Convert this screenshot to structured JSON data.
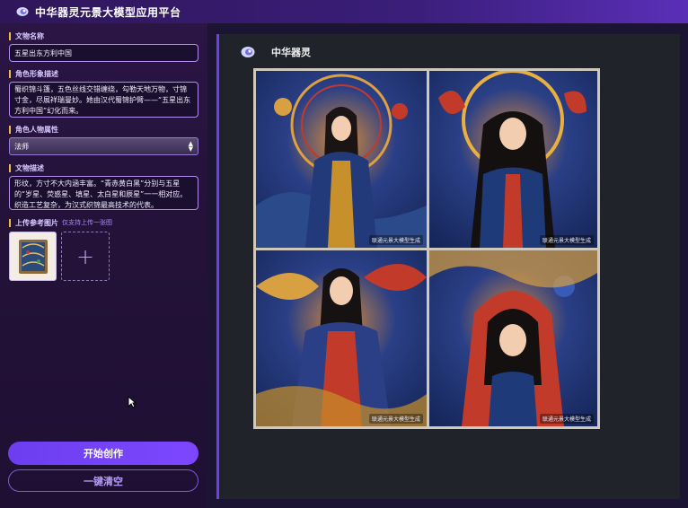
{
  "app": {
    "title": "中华器灵元景大模型应用平台"
  },
  "sidebar": {
    "artifact_name": {
      "label": "文物名称",
      "value": "五星出东方利中国"
    },
    "character_desc": {
      "label": "角色形象描述",
      "value": "蜀织锦斗篷，五色丝线交错缠绕，勾勒天地万物，寸锦寸金，尽展祥瑞曼妙。她由汉代蜀锦护臂——“五星出东方利中国”幻化而来。"
    },
    "character_attr": {
      "label": "角色人物属性",
      "value": "法师"
    },
    "artifact_desc": {
      "label": "文物描述",
      "value": "形纹，方寸不大内涵丰富。“青赤黄白黑”分别与五星的“岁星、荧惑星、填星、太白星和辰星”一一相对应。织造工艺复杂，为汉式织锦最高技术的代表。"
    },
    "upload": {
      "label": "上传参考图片",
      "hint": "仅支持上传一张图"
    },
    "start_button": "开始创作",
    "clear_button": "一键清空"
  },
  "panel": {
    "title": "中华器灵",
    "images": [
      {
        "caption": "联通元景大模型生成"
      },
      {
        "caption": "联通元景大模型生成"
      },
      {
        "caption": "联通元景大模型生成"
      },
      {
        "caption": "联通元景大模型生成"
      }
    ]
  },
  "colors": {
    "accent": "#6c3ef0",
    "topbar": "#3a1e7a",
    "sidebar_bg": "#241238",
    "panel_bg": "#20232a",
    "label_marker": "#f0b84b"
  }
}
